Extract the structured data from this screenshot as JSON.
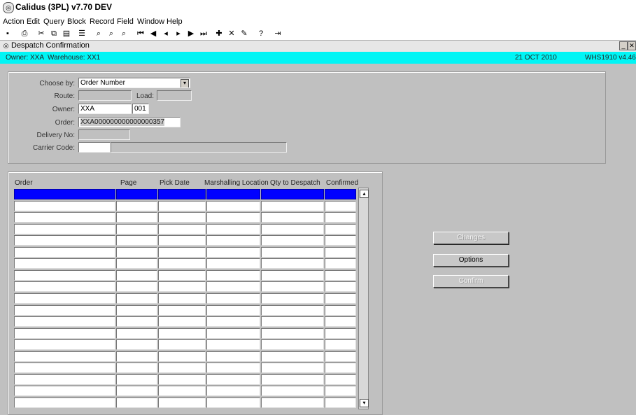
{
  "app": {
    "title": "Calidus (3PL) v7.70 DEV"
  },
  "menu": [
    "Action",
    "Edit",
    "Query",
    "Block",
    "Record",
    "Field",
    "Window",
    "Help"
  ],
  "window": {
    "title": "Despatch Confirmation"
  },
  "info": {
    "owner": "Owner: XXA",
    "warehouse": "Warehouse: XX1",
    "date": "21 OCT 2010",
    "screen": "WHS1910  v4.46"
  },
  "form": {
    "choose_by_label": "Choose by:",
    "choose_by_value": "Order Number",
    "route_label": "Route:",
    "route_value": "",
    "load_label": "Load:",
    "load_value": "",
    "owner_label": "Owner:",
    "owner_code": "XXA",
    "owner_num": "001",
    "order_label": "Order:",
    "order_value": "XXA000000000000000357",
    "delivery_label": "Delivery No:",
    "delivery_value": "",
    "carrier_label": "Carrier Code:",
    "carrier_code": "",
    "carrier_desc": ""
  },
  "grid": {
    "columns": [
      "Order",
      "Page",
      "Pick Date",
      "Marshalling Location",
      "Qty to Despatch",
      "Confirmed"
    ],
    "rows": [
      [
        "",
        "",
        "",
        "",
        "",
        ""
      ],
      [
        "",
        "",
        "",
        "",
        "",
        ""
      ],
      [
        "",
        "",
        "",
        "",
        "",
        ""
      ],
      [
        "",
        "",
        "",
        "",
        "",
        ""
      ],
      [
        "",
        "",
        "",
        "",
        "",
        ""
      ],
      [
        "",
        "",
        "",
        "",
        "",
        ""
      ],
      [
        "",
        "",
        "",
        "",
        "",
        ""
      ],
      [
        "",
        "",
        "",
        "",
        "",
        ""
      ],
      [
        "",
        "",
        "",
        "",
        "",
        ""
      ],
      [
        "",
        "",
        "",
        "",
        "",
        ""
      ],
      [
        "",
        "",
        "",
        "",
        "",
        ""
      ],
      [
        "",
        "",
        "",
        "",
        "",
        ""
      ],
      [
        "",
        "",
        "",
        "",
        "",
        ""
      ],
      [
        "",
        "",
        "",
        "",
        "",
        ""
      ],
      [
        "",
        "",
        "",
        "",
        "",
        ""
      ],
      [
        "",
        "",
        "",
        "",
        "",
        ""
      ],
      [
        "",
        "",
        "",
        "",
        "",
        ""
      ],
      [
        "",
        "",
        "",
        "",
        "",
        ""
      ],
      [
        "",
        "",
        "",
        "",
        "",
        ""
      ]
    ]
  },
  "buttons": {
    "changes": "Changes",
    "options": "Options",
    "confirm": "Confirm"
  }
}
